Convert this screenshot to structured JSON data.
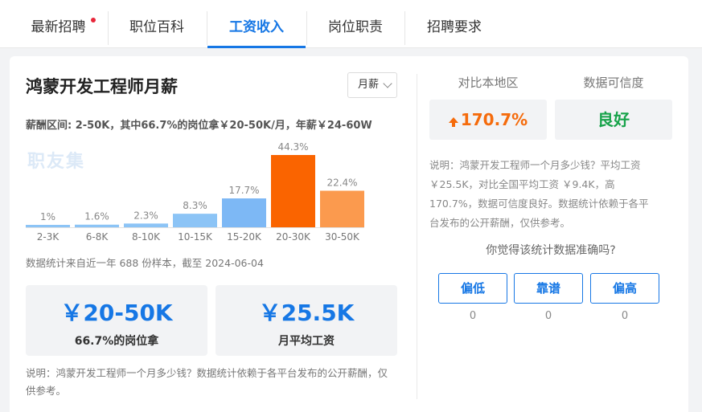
{
  "tabs": [
    {
      "label": "最新招聘",
      "badge": true
    },
    {
      "label": "职位百科",
      "badge": false
    },
    {
      "label": "工资收入",
      "badge": false,
      "active": true
    },
    {
      "label": "岗位职责",
      "badge": false
    },
    {
      "label": "招聘要求",
      "badge": false
    }
  ],
  "salary": {
    "title": "鸿蒙开发工程师月薪",
    "period_select": "月薪",
    "range_text": "薪酬区间: 2-50K，其中66.7%的岗位拿￥20-50K/月，年薪￥24-60W",
    "watermark": "职友集",
    "sample_note": "数据统计来自近一年 688 份样本，截至 2024-06-04",
    "box_range_value": "￥20-50K",
    "box_range_label": "66.7%的岗位拿",
    "box_avg_value": "￥25.5K",
    "box_avg_label": "月平均工资",
    "note": "说明：鸿蒙开发工程师一个月多少钱？数据统计依赖于各平台发布的公开薪酬，仅供参考。"
  },
  "chart_data": {
    "type": "bar",
    "categories": [
      "2-3K",
      "6-8K",
      "8-10K",
      "10-15K",
      "15-20K",
      "20-30K",
      "30-50K"
    ],
    "values": [
      1,
      1.6,
      2.3,
      8.3,
      17.7,
      44.3,
      22.4
    ],
    "value_labels": [
      "1%",
      "1.6%",
      "2.3%",
      "8.3%",
      "17.7%",
      "44.3%",
      "22.4%"
    ],
    "colors": [
      "#8cc4f6",
      "#8cc4f6",
      "#8cc4f6",
      "#8cc4f6",
      "#7db8f5",
      "#fa6400",
      "#fb9a4e"
    ],
    "title": "",
    "xlabel": "",
    "ylabel": "",
    "ylim": [
      0,
      44.3
    ],
    "grid": false
  },
  "compare": {
    "local_header": "对比本地区",
    "local_value": "170.7%",
    "reliability_header": "数据可信度",
    "reliability_value": "良好",
    "note": "说明：鸿蒙开发工程师一个月多少钱？平均工资 ￥25.5K，对比全国平均工资 ￥9.4K，高170.7%，数据可信度良好。数据统计依赖于各平台发布的公开薪酬，仅供参考。",
    "question": "你觉得该统计数据准确吗?",
    "votes": [
      {
        "label": "偏低",
        "count": "0"
      },
      {
        "label": "靠谱",
        "count": "0"
      },
      {
        "label": "偏高",
        "count": "0"
      }
    ]
  }
}
